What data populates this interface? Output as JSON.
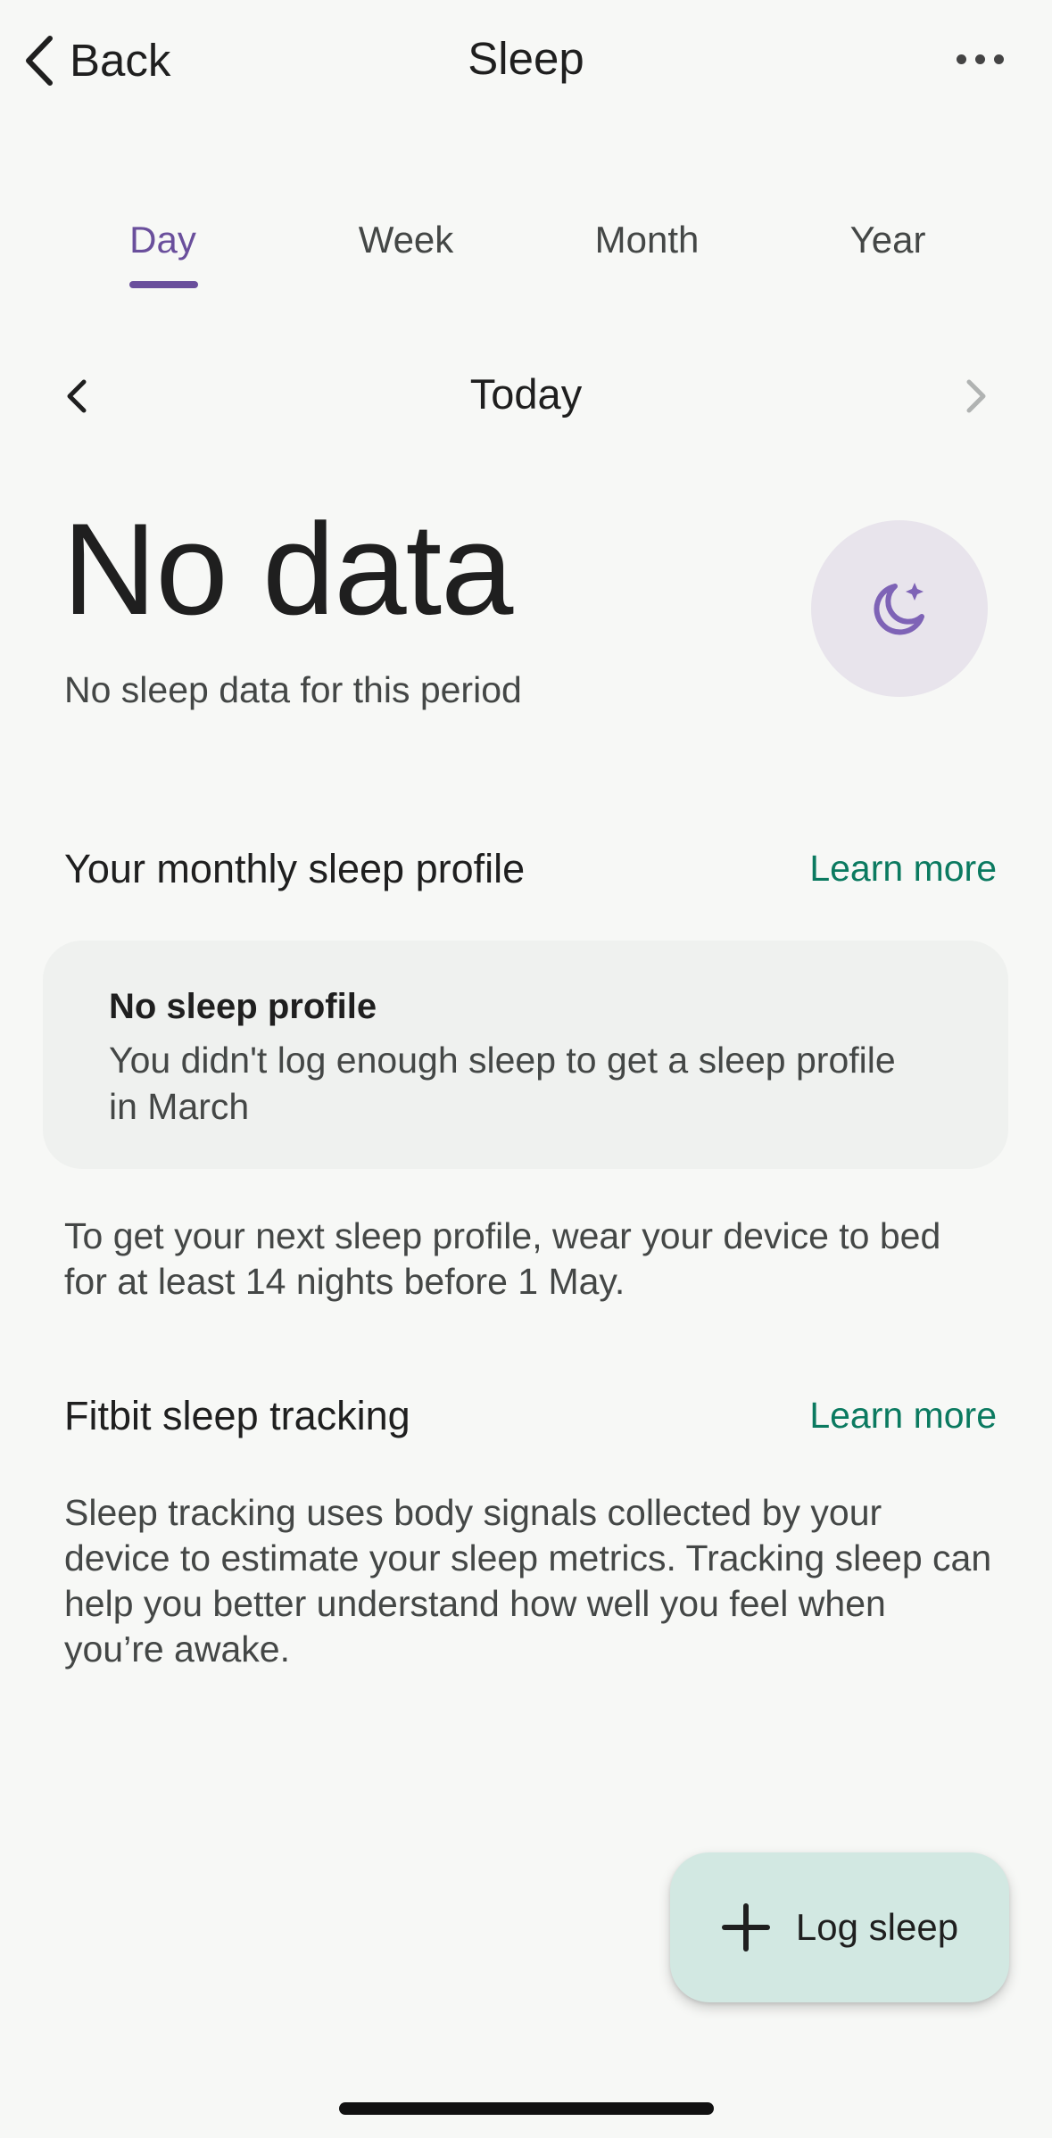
{
  "header": {
    "back_label": "Back",
    "title": "Sleep"
  },
  "tabs": [
    {
      "label": "Day",
      "active": true
    },
    {
      "label": "Week",
      "active": false
    },
    {
      "label": "Month",
      "active": false
    },
    {
      "label": "Year",
      "active": false
    }
  ],
  "date_nav": {
    "label": "Today"
  },
  "summary": {
    "headline": "No data",
    "subtitle": "No sleep data for this period"
  },
  "profile_section": {
    "title": "Your monthly sleep profile",
    "learn_more": "Learn more",
    "card_title": "No sleep profile",
    "card_body": "You didn't log enough sleep to get a sleep profile in March",
    "note": "To get your next sleep profile, wear your device to bed for at least 14 nights before 1 May."
  },
  "tracking_section": {
    "title": "Fitbit sleep tracking",
    "learn_more": "Learn more",
    "body": "Sleep tracking uses body signals collected by your device to estimate your sleep metrics. Tracking sleep can help you better understand how well you feel when you’re awake."
  },
  "fab": {
    "label": "Log sleep"
  },
  "colors": {
    "accent": "#6a4f9c",
    "link": "#0b7a60",
    "fab_bg": "#d2e8e2",
    "moon_bg": "#e8e4ec"
  },
  "icons": [
    "chevron-left-icon",
    "more-horizontal-icon",
    "moon-stars-icon",
    "plus-icon"
  ]
}
